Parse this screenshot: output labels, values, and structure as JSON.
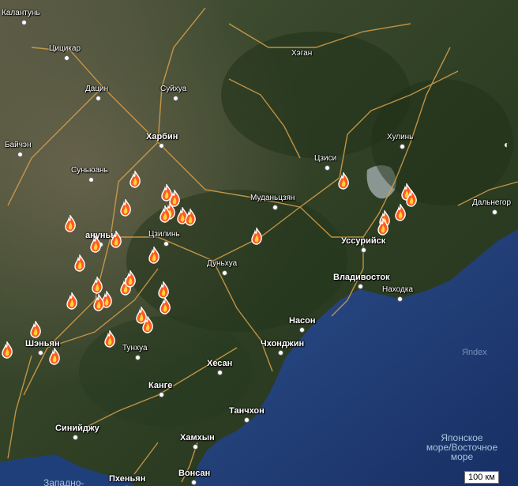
{
  "map": {
    "brand": "Яndex",
    "scale_label": "100 км",
    "sea_label_lines": [
      "Японское",
      "море/Восточное",
      "море"
    ],
    "cities": [
      {
        "name": "Калантунь",
        "cls": "small"
      },
      {
        "name": "Цицикар",
        "cls": "small"
      },
      {
        "name": "Дацин",
        "cls": "small"
      },
      {
        "name": "Суйхуа",
        "cls": "small"
      },
      {
        "name": "Харбин",
        "cls": "big"
      },
      {
        "name": "Хэган",
        "cls": "small"
      },
      {
        "name": "Цзиси",
        "cls": "small"
      },
      {
        "name": "Хулинь",
        "cls": "small"
      },
      {
        "name": "Байчэн",
        "cls": "small"
      },
      {
        "name": "Суньюань",
        "cls": "small"
      },
      {
        "name": "Муданьцзян",
        "cls": "small"
      },
      {
        "name": "Дальнегор",
        "cls": "small"
      },
      {
        "name": "ануньь",
        "cls": "big"
      },
      {
        "name": "Цзилинь",
        "cls": "small"
      },
      {
        "name": "Уссурийск",
        "cls": "big"
      },
      {
        "name": "Дуньхуа",
        "cls": "small"
      },
      {
        "name": "Владивосток",
        "cls": "big"
      },
      {
        "name": "Находка",
        "cls": "small"
      },
      {
        "name": "Насон",
        "cls": "big"
      },
      {
        "name": "Шэньян",
        "cls": "big"
      },
      {
        "name": "Тунхуа",
        "cls": "small"
      },
      {
        "name": "Чхонджин",
        "cls": "big"
      },
      {
        "name": "Хесан",
        "cls": "big"
      },
      {
        "name": "Канге",
        "cls": "big"
      },
      {
        "name": "Танчхон",
        "cls": "big"
      },
      {
        "name": "Синийджу",
        "cls": "big"
      },
      {
        "name": "Хамхын",
        "cls": "big"
      },
      {
        "name": "Пхеньян",
        "cls": "big"
      },
      {
        "name": "Вонсан",
        "cls": "big"
      },
      {
        "name": "Западно-",
        "cls": "sea"
      }
    ],
    "fire_count": 34,
    "colors": {
      "land": "#2e3f24",
      "sea": "#1f3b73",
      "road": "#d9a14a",
      "fire": "#ff5a1f"
    }
  }
}
